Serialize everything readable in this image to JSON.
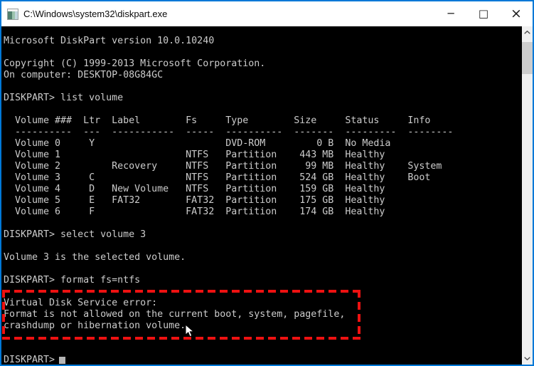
{
  "window": {
    "title": "C:\\Windows\\system32\\diskpart.exe",
    "icons": {
      "app_icon": "console-window",
      "minimize": "─",
      "maximize": "□",
      "close": "×",
      "scroll_up": "chevron-up",
      "scroll_down": "chevron-down",
      "mouse_pointer": "arrow-cursor"
    }
  },
  "console": {
    "prompt": "DISKPART>",
    "lines": [
      "Microsoft DiskPart version 10.0.10240",
      "",
      "Copyright (C) 1999-2013 Microsoft Corporation.",
      "On computer: DESKTOP-08G84GC",
      "",
      "DISKPART> list volume",
      "",
      "  Volume ###  Ltr  Label        Fs     Type        Size     Status     Info",
      "  ----------  ---  -----------  -----  ----------  -------  ---------  --------",
      "  Volume 0     Y                       DVD-ROM         0 B  No Media",
      "  Volume 1                      NTFS   Partition    443 MB  Healthy",
      "  Volume 2         Recovery     NTFS   Partition     99 MB  Healthy    System",
      "  Volume 3     C                NTFS   Partition    524 GB  Healthy    Boot",
      "  Volume 4     D   New Volume   NTFS   Partition    159 GB  Healthy",
      "  Volume 5     E   FAT32        FAT32  Partition    175 GB  Healthy",
      "  Volume 6     F                FAT32  Partition    174 GB  Healthy",
      "",
      "DISKPART> select volume 3",
      "",
      "Volume 3 is the selected volume.",
      "",
      "DISKPART> format fs=ntfs",
      "",
      "Virtual Disk Service error:",
      "Format is not allowed on the current boot, system, pagefile,",
      "crashdump or hibernation volume.",
      "",
      "",
      "DISKPART> "
    ]
  },
  "volume_table": {
    "headers": [
      "Volume ###",
      "Ltr",
      "Label",
      "Fs",
      "Type",
      "Size",
      "Status",
      "Info"
    ],
    "rows": [
      {
        "volume": "Volume 0",
        "ltr": "Y",
        "label": "",
        "fs": "",
        "type": "DVD-ROM",
        "size": "0 B",
        "status": "No Media",
        "info": ""
      },
      {
        "volume": "Volume 1",
        "ltr": "",
        "label": "",
        "fs": "NTFS",
        "type": "Partition",
        "size": "443 MB",
        "status": "Healthy",
        "info": ""
      },
      {
        "volume": "Volume 2",
        "ltr": "",
        "label": "Recovery",
        "fs": "NTFS",
        "type": "Partition",
        "size": "99 MB",
        "status": "Healthy",
        "info": "System"
      },
      {
        "volume": "Volume 3",
        "ltr": "C",
        "label": "",
        "fs": "NTFS",
        "type": "Partition",
        "size": "524 GB",
        "status": "Healthy",
        "info": "Boot"
      },
      {
        "volume": "Volume 4",
        "ltr": "D",
        "label": "New Volume",
        "fs": "NTFS",
        "type": "Partition",
        "size": "159 GB",
        "status": "Healthy",
        "info": ""
      },
      {
        "volume": "Volume 5",
        "ltr": "E",
        "label": "FAT32",
        "fs": "FAT32",
        "type": "Partition",
        "size": "175 GB",
        "status": "Healthy",
        "info": ""
      },
      {
        "volume": "Volume 6",
        "ltr": "F",
        "label": "",
        "fs": "FAT32",
        "type": "Partition",
        "size": "174 GB",
        "status": "Healthy",
        "info": ""
      }
    ]
  },
  "error": {
    "source": "Virtual Disk Service error:",
    "message": "Format is not allowed on the current boot, system, pagefile, crashdump or hibernation volume."
  },
  "colors": {
    "window_border": "#0078d7",
    "titlebar_bg": "#ffffff",
    "titlebar_text": "#000000",
    "console_bg": "#000000",
    "console_text": "#cccccc",
    "error_box_border": "#ee1111",
    "scrollbar_track": "#f0f0f0",
    "scrollbar_thumb": "#cdcdcd",
    "scrollbar_arrow": "#505050",
    "text_cursor": "#b5b5b5"
  }
}
